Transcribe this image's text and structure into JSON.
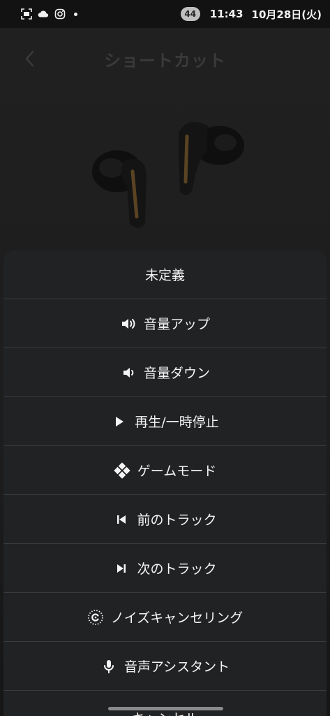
{
  "status_bar": {
    "time": "11:43",
    "date": "10月28日(火)",
    "battery": "44",
    "icons": [
      "screenshot-icon",
      "cloud-icon",
      "instagram-icon",
      "notification-dot-icon"
    ]
  },
  "app": {
    "title": "ショートカット",
    "back_icon": "chevron-left-icon"
  },
  "sheet": {
    "options": [
      {
        "label": "未定義",
        "icon": ""
      },
      {
        "label": "音量アップ",
        "icon": "volume-up-icon"
      },
      {
        "label": "音量ダウン",
        "icon": "volume-down-icon"
      },
      {
        "label": "再生/一時停止",
        "icon": "play-icon"
      },
      {
        "label": "ゲームモード",
        "icon": "game-mode-icon"
      },
      {
        "label": "前のトラック",
        "icon": "previous-track-icon"
      },
      {
        "label": "次のトラック",
        "icon": "next-track-icon"
      },
      {
        "label": "ノイズキャンセリング",
        "icon": "noise-cancelling-icon"
      },
      {
        "label": "音声アシスタント",
        "icon": "microphone-icon"
      }
    ],
    "cancel_label": "キャンセル"
  },
  "colors": {
    "sheet_background": "#212224",
    "divider": "#3a3b3e",
    "text": "#f4f4f4"
  }
}
